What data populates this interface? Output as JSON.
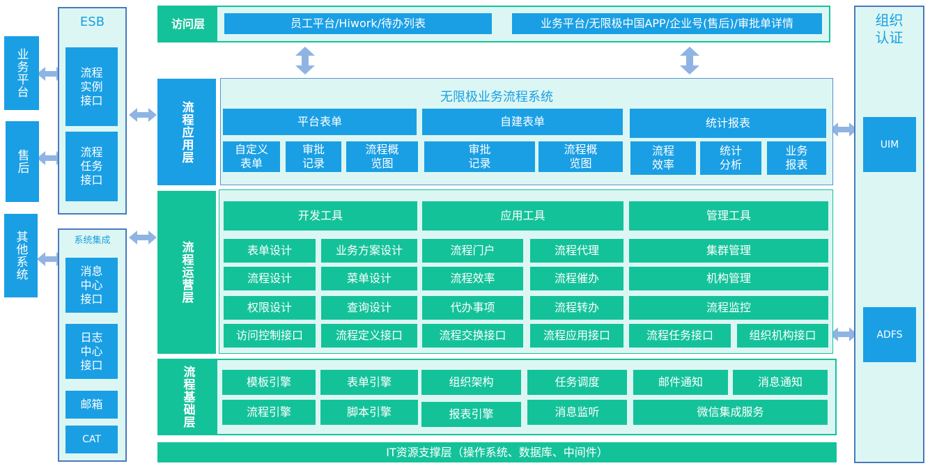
{
  "left_side": {
    "business_platform": "业务平台",
    "after_sales": "售后",
    "other_systems": "其他系统"
  },
  "esb": {
    "title": "ESB",
    "items": [
      "流程\n实例\n接口",
      "流程\n任务\n接口"
    ]
  },
  "system_integration": {
    "title": "系统集成",
    "items": [
      "消息\n中心\n接口",
      "日志\n中心\n接口",
      "邮箱",
      "CAT"
    ]
  },
  "access_layer": {
    "label": "访问层",
    "items": [
      "员工平台/Hiwork/待办列表",
      "业务平台/无限极中国APP/企业号(售后)/审批单详情"
    ]
  },
  "app_layer": {
    "label": "流程应用层",
    "system_title": "无限极业务流程系统",
    "groups": [
      {
        "title": "平台表单",
        "items": [
          "自定义\n表单",
          "审批\n记录",
          "流程概\n览图"
        ]
      },
      {
        "title": "自建表单",
        "items": [
          "审批\n记录",
          "流程概\n览图"
        ]
      },
      {
        "title": "统计报表",
        "items": [
          "流程\n效率",
          "统计\n分析",
          "业务\n报表"
        ]
      }
    ]
  },
  "ops_layer": {
    "label": "流程运营层",
    "groups": [
      {
        "title": "开发工具",
        "items": [
          "表单设计",
          "业务方案设计",
          "流程设计",
          "菜单设计",
          "权限设计",
          "查询设计",
          "访问控制接口",
          "流程定义接口"
        ]
      },
      {
        "title": "应用工具",
        "items": [
          "流程门户",
          "流程代理",
          "流程效率",
          "流程催办",
          "代办事项",
          "流程转办",
          "流程交换接口",
          "流程应用接口"
        ]
      },
      {
        "title": "管理工具",
        "items": [
          "集群管理",
          "机构管理",
          "流程监控",
          "流程任务接口",
          "组织机构接口"
        ]
      }
    ]
  },
  "base_layer": {
    "label": "流程基础层",
    "items": [
      "模板引擎",
      "表单引擎",
      "组织架构",
      "任务调度",
      "邮件通知",
      "消息通知",
      "流程引擎",
      "脚本引擎",
      "报表引擎",
      "消息监听",
      "微信集成服务"
    ]
  },
  "it_layer": {
    "label": "IT资源支撑层（操作系统、数据库、中间件）"
  },
  "org_auth": {
    "title": "组织\n认证",
    "items": [
      "UIM",
      "ADFS"
    ]
  },
  "colors": {
    "blue": "#1a9fe4",
    "green": "#14c29a",
    "mint": "#dcf7f3",
    "frame": "#4a79bd",
    "arrow": "#8fb4e3"
  }
}
